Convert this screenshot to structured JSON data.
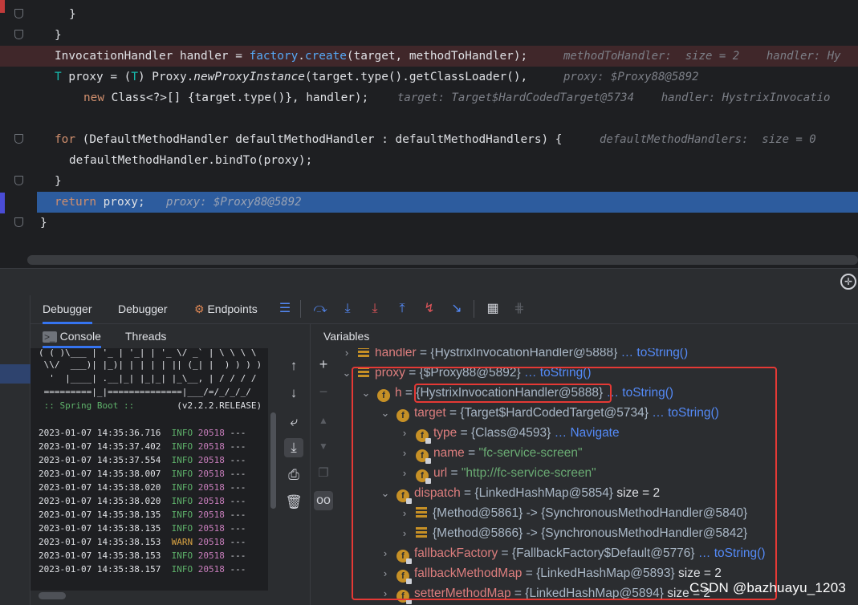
{
  "editor": {
    "lines": [
      {
        "text": "}"
      },
      {
        "text": "}"
      },
      {
        "parts": [
          "InvocationHandler handler = ",
          "factory",
          ".",
          "create",
          "(target, methodToHandler);"
        ],
        "hint": "methodToHandler:  size = 2    handler: Hy"
      },
      {
        "parts": [
          "T",
          " proxy = (",
          "T",
          ") Proxy.",
          "newProxyInstance",
          "(target.type().getClassLoader(),"
        ],
        "hint": "proxy: $Proxy88@5892"
      },
      {
        "parts": [
          "new",
          " Class<?>[] {target.type()}, handler);"
        ],
        "hint": "target: Target$HardCodedTarget@5734    handler: HystrixInvocatio"
      },
      {
        "parts": [
          "for",
          " (DefaultMethodHandler defaultMethodHandler : defaultMethodHandlers) {"
        ],
        "hint": "defaultMethodHandlers:  size = 0"
      },
      {
        "parts": [
          "defaultMethodHandler.bindTo(proxy);"
        ]
      },
      {
        "text": "}"
      },
      {
        "parts": [
          "return",
          " proxy;"
        ],
        "hint": "proxy: $Proxy88@5892"
      },
      {
        "text": "}"
      }
    ]
  },
  "toolwindow": {
    "tabs": [
      "Debugger",
      "Debugger",
      "Endpoints"
    ],
    "console_tabs": [
      "Console",
      "Threads"
    ],
    "variables_title": "Variables"
  },
  "console": {
    "banner": [
      "( ( )\\___ | '_ | '_| | '_ \\/ _` | \\ \\ \\ \\",
      " \\\\/  ___)| |_)| | | | | || (_| |  ) ) ) )",
      "  '  |____| .__|_| |_|_| |_\\__, | / / / /",
      " =========|_|==============|___/=/_/_/_/"
    ],
    "spring_label": " :: Spring Boot ::",
    "spring_version": "        (v2.2.2.RELEASE)",
    "logs": [
      {
        "ts": "2023-01-07 14:35:36.716",
        "level": "INFO",
        "pid": "20518",
        "rest": "---"
      },
      {
        "ts": "2023-01-07 14:35:37.402",
        "level": "INFO",
        "pid": "20518",
        "rest": "---"
      },
      {
        "ts": "2023-01-07 14:35:37.554",
        "level": "INFO",
        "pid": "20518",
        "rest": "---"
      },
      {
        "ts": "2023-01-07 14:35:38.007",
        "level": "INFO",
        "pid": "20518",
        "rest": "---"
      },
      {
        "ts": "2023-01-07 14:35:38.020",
        "level": "INFO",
        "pid": "20518",
        "rest": "---"
      },
      {
        "ts": "2023-01-07 14:35:38.020",
        "level": "INFO",
        "pid": "20518",
        "rest": "---"
      },
      {
        "ts": "2023-01-07 14:35:38.135",
        "level": "INFO",
        "pid": "20518",
        "rest": "---"
      },
      {
        "ts": "2023-01-07 14:35:38.135",
        "level": "INFO",
        "pid": "20518",
        "rest": "---"
      },
      {
        "ts": "2023-01-07 14:35:38.153",
        "level": "WARN",
        "pid": "20518",
        "rest": "---"
      },
      {
        "ts": "2023-01-07 14:35:38.153",
        "level": "INFO",
        "pid": "20518",
        "rest": "---"
      },
      {
        "ts": "2023-01-07 14:35:38.157",
        "level": "INFO",
        "pid": "20518",
        "rest": "---"
      }
    ]
  },
  "variables": [
    {
      "arrow": "›",
      "icon": "list",
      "name": "handler",
      "value": "{HystrixInvocationHandler@5888}",
      "link": "toString()"
    },
    {
      "arrow": "⌄",
      "icon": "list",
      "name": "proxy",
      "value": "{$Proxy88@5892}",
      "link": "toString()"
    },
    {
      "arrow": "⌄",
      "icon": "field",
      "name": "h",
      "value": "{HystrixInvocationHandler@5888}",
      "link": "toString()"
    },
    {
      "arrow": "⌄",
      "icon": "field",
      "name": "target",
      "value": "{Target$HardCodedTarget@5734}",
      "link": "toString()"
    },
    {
      "arrow": "›",
      "icon": "field-lock",
      "name": "type",
      "value": "{Class@4593}",
      "link": "Navigate"
    },
    {
      "arrow": "›",
      "icon": "field-lock",
      "name": "name",
      "string": "\"fc-service-screen\""
    },
    {
      "arrow": "›",
      "icon": "field-lock",
      "name": "url",
      "string": "\"http://fc-service-screen\""
    },
    {
      "arrow": "⌄",
      "icon": "field-lock",
      "name": "dispatch",
      "value": "{LinkedHashMap@5854}",
      "size": "size = 2"
    },
    {
      "arrow": "›",
      "icon": "list",
      "entry": "{Method@5861}  -> {SynchronousMethodHandler@5840}"
    },
    {
      "arrow": "›",
      "icon": "list",
      "entry": "{Method@5866}  -> {SynchronousMethodHandler@5842}"
    },
    {
      "arrow": "›",
      "icon": "field-lock",
      "name": "fallbackFactory",
      "value": "{FallbackFactory$Default@5776}",
      "link": "toString()"
    },
    {
      "arrow": "›",
      "icon": "field-lock",
      "name": "fallbackMethodMap",
      "value": "{LinkedHashMap@5893}",
      "size": "size = 2"
    },
    {
      "arrow": "›",
      "icon": "field-lock",
      "name": "setterMethodMap",
      "value": "{LinkedHashMap@5894}",
      "size": "size = 2"
    }
  ],
  "watermark": "CSDN @bazhuayu_1203",
  "colors": {
    "accent": "#3574f0",
    "current_line": "#2d5c9e",
    "exec_line": "#40272a",
    "highlight_box": "#e53935"
  }
}
